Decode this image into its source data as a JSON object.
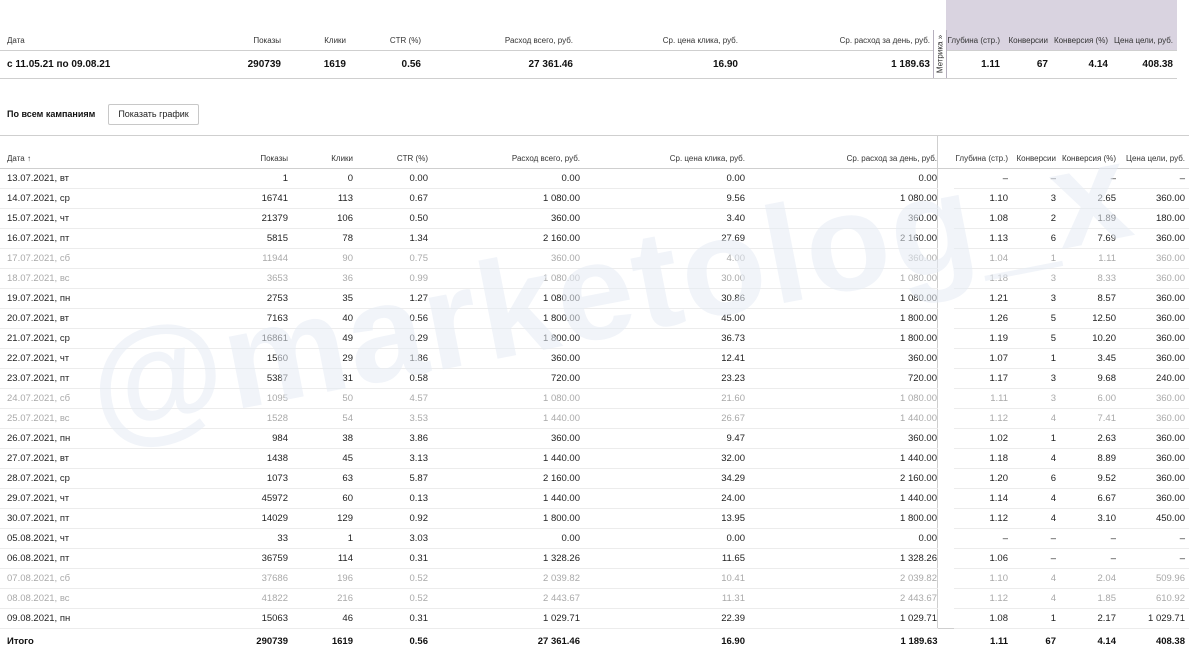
{
  "columns": {
    "date": "Дата",
    "date_sorted": "Дата ↑",
    "impressions": "Показы",
    "clicks": "Клики",
    "ctr": "CTR (%)",
    "spend": "Расход всего, руб.",
    "cpc": "Ср. цена клика, руб.",
    "daily_spend": "Ср. расход за день, руб.",
    "metrika_tab": "Метрика »",
    "depth": "Глубина (стр.)",
    "conversions": "Конверсии",
    "conv_rate": "Конверсия (%)",
    "cost_per_goal": "Цена цели, руб."
  },
  "summary": {
    "period": "с 11.05.21 по 09.08.21",
    "impressions": "290739",
    "clicks": "1619",
    "ctr": "0.56",
    "spend": "27 361.46",
    "cpc": "16.90",
    "daily_spend": "1 189.63",
    "depth": "1.11",
    "conversions": "67",
    "conv_rate": "4.14",
    "cost_per_goal": "408.38"
  },
  "campaigns": {
    "label": "По всем кампаниям",
    "chart_button": "Показать график"
  },
  "rows": [
    {
      "date": "13.07.2021, вт",
      "imp": "1",
      "clk": "0",
      "ctr": "0.00",
      "spd": "0.00",
      "cpc": "0.00",
      "day": "0.00",
      "dep": "–",
      "cnv": "–",
      "cnp": "–",
      "cpg": "–",
      "dim": false
    },
    {
      "date": "14.07.2021, ср",
      "imp": "16741",
      "clk": "113",
      "ctr": "0.67",
      "spd": "1 080.00",
      "cpc": "9.56",
      "day": "1 080.00",
      "dep": "1.10",
      "cnv": "3",
      "cnp": "2.65",
      "cpg": "360.00",
      "dim": false
    },
    {
      "date": "15.07.2021, чт",
      "imp": "21379",
      "clk": "106",
      "ctr": "0.50",
      "spd": "360.00",
      "cpc": "3.40",
      "day": "360.00",
      "dep": "1.08",
      "cnv": "2",
      "cnp": "1.89",
      "cpg": "180.00",
      "dim": false
    },
    {
      "date": "16.07.2021, пт",
      "imp": "5815",
      "clk": "78",
      "ctr": "1.34",
      "spd": "2 160.00",
      "cpc": "27.69",
      "day": "2 160.00",
      "dep": "1.13",
      "cnv": "6",
      "cnp": "7.69",
      "cpg": "360.00",
      "dim": false
    },
    {
      "date": "17.07.2021, сб",
      "imp": "11944",
      "clk": "90",
      "ctr": "0.75",
      "spd": "360.00",
      "cpc": "4.00",
      "day": "360.00",
      "dep": "1.04",
      "cnv": "1",
      "cnp": "1.11",
      "cpg": "360.00",
      "dim": true
    },
    {
      "date": "18.07.2021, вс",
      "imp": "3653",
      "clk": "36",
      "ctr": "0.99",
      "spd": "1 080.00",
      "cpc": "30.00",
      "day": "1 080.00",
      "dep": "1.18",
      "cnv": "3",
      "cnp": "8.33",
      "cpg": "360.00",
      "dim": true
    },
    {
      "date": "19.07.2021, пн",
      "imp": "2753",
      "clk": "35",
      "ctr": "1.27",
      "spd": "1 080.00",
      "cpc": "30.86",
      "day": "1 080.00",
      "dep": "1.21",
      "cnv": "3",
      "cnp": "8.57",
      "cpg": "360.00",
      "dim": false
    },
    {
      "date": "20.07.2021, вт",
      "imp": "7163",
      "clk": "40",
      "ctr": "0.56",
      "spd": "1 800.00",
      "cpc": "45.00",
      "day": "1 800.00",
      "dep": "1.26",
      "cnv": "5",
      "cnp": "12.50",
      "cpg": "360.00",
      "dim": false
    },
    {
      "date": "21.07.2021, ср",
      "imp": "16861",
      "clk": "49",
      "ctr": "0.29",
      "spd": "1 800.00",
      "cpc": "36.73",
      "day": "1 800.00",
      "dep": "1.19",
      "cnv": "5",
      "cnp": "10.20",
      "cpg": "360.00",
      "dim": false
    },
    {
      "date": "22.07.2021, чт",
      "imp": "1560",
      "clk": "29",
      "ctr": "1.86",
      "spd": "360.00",
      "cpc": "12.41",
      "day": "360.00",
      "dep": "1.07",
      "cnv": "1",
      "cnp": "3.45",
      "cpg": "360.00",
      "dim": false
    },
    {
      "date": "23.07.2021, пт",
      "imp": "5387",
      "clk": "31",
      "ctr": "0.58",
      "spd": "720.00",
      "cpc": "23.23",
      "day": "720.00",
      "dep": "1.17",
      "cnv": "3",
      "cnp": "9.68",
      "cpg": "240.00",
      "dim": false
    },
    {
      "date": "24.07.2021, сб",
      "imp": "1095",
      "clk": "50",
      "ctr": "4.57",
      "spd": "1 080.00",
      "cpc": "21.60",
      "day": "1 080.00",
      "dep": "1.11",
      "cnv": "3",
      "cnp": "6.00",
      "cpg": "360.00",
      "dim": true
    },
    {
      "date": "25.07.2021, вс",
      "imp": "1528",
      "clk": "54",
      "ctr": "3.53",
      "spd": "1 440.00",
      "cpc": "26.67",
      "day": "1 440.00",
      "dep": "1.12",
      "cnv": "4",
      "cnp": "7.41",
      "cpg": "360.00",
      "dim": true
    },
    {
      "date": "26.07.2021, пн",
      "imp": "984",
      "clk": "38",
      "ctr": "3.86",
      "spd": "360.00",
      "cpc": "9.47",
      "day": "360.00",
      "dep": "1.02",
      "cnv": "1",
      "cnp": "2.63",
      "cpg": "360.00",
      "dim": false
    },
    {
      "date": "27.07.2021, вт",
      "imp": "1438",
      "clk": "45",
      "ctr": "3.13",
      "spd": "1 440.00",
      "cpc": "32.00",
      "day": "1 440.00",
      "dep": "1.18",
      "cnv": "4",
      "cnp": "8.89",
      "cpg": "360.00",
      "dim": false
    },
    {
      "date": "28.07.2021, ср",
      "imp": "1073",
      "clk": "63",
      "ctr": "5.87",
      "spd": "2 160.00",
      "cpc": "34.29",
      "day": "2 160.00",
      "dep": "1.20",
      "cnv": "6",
      "cnp": "9.52",
      "cpg": "360.00",
      "dim": false
    },
    {
      "date": "29.07.2021, чт",
      "imp": "45972",
      "clk": "60",
      "ctr": "0.13",
      "spd": "1 440.00",
      "cpc": "24.00",
      "day": "1 440.00",
      "dep": "1.14",
      "cnv": "4",
      "cnp": "6.67",
      "cpg": "360.00",
      "dim": false
    },
    {
      "date": "30.07.2021, пт",
      "imp": "14029",
      "clk": "129",
      "ctr": "0.92",
      "spd": "1 800.00",
      "cpc": "13.95",
      "day": "1 800.00",
      "dep": "1.12",
      "cnv": "4",
      "cnp": "3.10",
      "cpg": "450.00",
      "dim": false
    },
    {
      "date": "05.08.2021, чт",
      "imp": "33",
      "clk": "1",
      "ctr": "3.03",
      "spd": "0.00",
      "cpc": "0.00",
      "day": "0.00",
      "dep": "–",
      "cnv": "–",
      "cnp": "–",
      "cpg": "–",
      "dim": false
    },
    {
      "date": "06.08.2021, пт",
      "imp": "36759",
      "clk": "114",
      "ctr": "0.31",
      "spd": "1 328.26",
      "cpc": "11.65",
      "day": "1 328.26",
      "dep": "1.06",
      "cnv": "–",
      "cnp": "–",
      "cpg": "–",
      "dim": false
    },
    {
      "date": "07.08.2021, сб",
      "imp": "37686",
      "clk": "196",
      "ctr": "0.52",
      "spd": "2 039.82",
      "cpc": "10.41",
      "day": "2 039.82",
      "dep": "1.10",
      "cnv": "4",
      "cnp": "2.04",
      "cpg": "509.96",
      "dim": true
    },
    {
      "date": "08.08.2021, вс",
      "imp": "41822",
      "clk": "216",
      "ctr": "0.52",
      "spd": "2 443.67",
      "cpc": "11.31",
      "day": "2 443.67",
      "dep": "1.12",
      "cnv": "4",
      "cnp": "1.85",
      "cpg": "610.92",
      "dim": true
    },
    {
      "date": "09.08.2021, пн",
      "imp": "15063",
      "clk": "46",
      "ctr": "0.31",
      "spd": "1 029.71",
      "cpc": "22.39",
      "day": "1 029.71",
      "dep": "1.08",
      "cnv": "1",
      "cnp": "2.17",
      "cpg": "1 029.71",
      "dim": false
    }
  ],
  "total": {
    "label": "Итого",
    "imp": "290739",
    "clk": "1619",
    "ctr": "0.56",
    "spd": "27 361.46",
    "cpc": "16.90",
    "day": "1 189.63",
    "dep": "1.11",
    "cnv": "67",
    "cnp": "4.14",
    "cpg": "408.38"
  },
  "watermark": "@marketolog_x",
  "colors": {
    "metrika_group_bg": "#d9d3e0",
    "dim_text": "#a9a9a9",
    "watermark": "#e6ecf5"
  }
}
